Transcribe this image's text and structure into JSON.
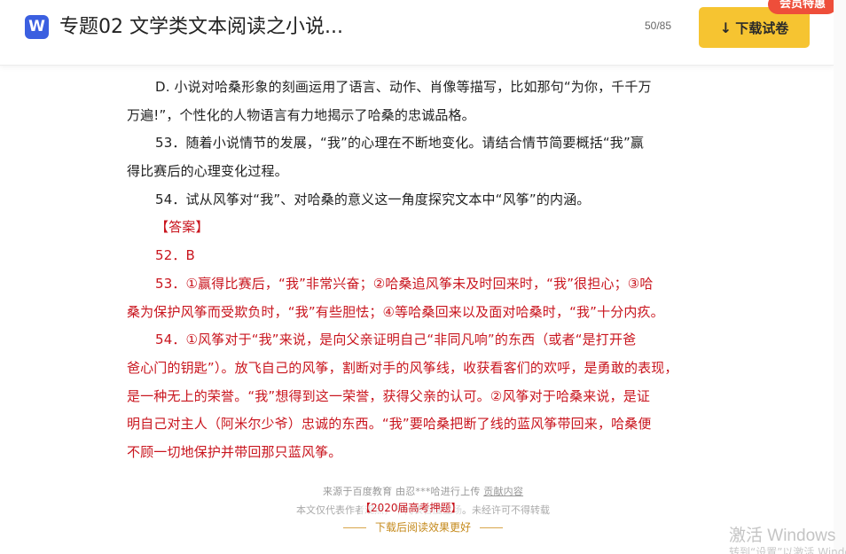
{
  "header": {
    "app_icon_letter": "W",
    "title": "专题02 文学类文本阅读之小说...",
    "page_counter": "50/85",
    "download_label": "下载试卷",
    "vip_badge": "会员特惠"
  },
  "document": {
    "lines": [
      {
        "text": "D. 小说对哈桑形象的刻画运用了语言、动作、肖像等描写，比如那句“为你，千千万",
        "indent": true,
        "red": false
      },
      {
        "text": "万遍!”，个性化的人物语言有力地揭示了哈桑的忠诚品格。",
        "indent": false,
        "red": false
      },
      {
        "text": "53．随着小说情节的发展，“我”的心理在不断地变化。请结合情节简要概括“我”赢",
        "indent": true,
        "red": false
      },
      {
        "text": "得比赛后的心理变化过程。",
        "indent": false,
        "red": false
      },
      {
        "text": "54．试从风筝对“我”、对哈桑的意义这一角度探究文本中“风筝”的内涵。",
        "indent": true,
        "red": false
      },
      {
        "text": "【答案】",
        "indent": true,
        "red": true
      },
      {
        "text": "52．B",
        "indent": true,
        "red": true
      },
      {
        "text": "53．①赢得比赛后，“我”非常兴奋；②哈桑追风筝未及时回来时，“我”很担心；③哈",
        "indent": true,
        "red": true
      },
      {
        "text": "桑为保护风筝而受欺负时，“我”有些胆怯；④等哈桑回来以及面对哈桑时，“我”十分内疚。",
        "indent": false,
        "red": true
      },
      {
        "text": "54．①风筝对于“我”来说，是向父亲证明自己“非同凡响”的东西（或者“是打开爸",
        "indent": true,
        "red": true
      },
      {
        "text": "爸心门的钥匙”）。放飞自己的风筝，割断对手的风筝线，收获看客们的欢呼，是勇敢的表现，",
        "indent": false,
        "red": true
      },
      {
        "text": "是一种无上的荣誉。“我”想得到这一荣誉，获得父亲的认可。②风筝对于哈桑来说，是证",
        "indent": false,
        "red": true
      },
      {
        "text": "明自己对主人（阿米尔少爷）忠诚的东西。“我”要哈桑把断了线的蓝风筝带回来，哈桑便",
        "indent": false,
        "red": true
      },
      {
        "text": "不顾一切地保护并带回那只蓝风筝。",
        "indent": false,
        "red": true
      }
    ]
  },
  "footer": {
    "source_text": "来源于百度教育 由忍***哈进行上传",
    "contribute_link": "贡献内容",
    "copyright": "本文仅代表作者观点，不代表百度立场。未经许可不得转载",
    "year_tag": "【2020届高考押题】",
    "read_better": "下载后阅读效果更好"
  },
  "watermark": {
    "title": "激活 Windows",
    "subtitle": "转到“设置”以激活 Windows。"
  },
  "colors": {
    "accent_blue": "#3b5fe0",
    "download_yellow": "#f6c431",
    "badge_red": "#ee4e3a",
    "answer_red": "#c9151e"
  },
  "icons": {
    "app_icon": "wenku-w-logo",
    "download_icon": "arrow-down-icon"
  }
}
